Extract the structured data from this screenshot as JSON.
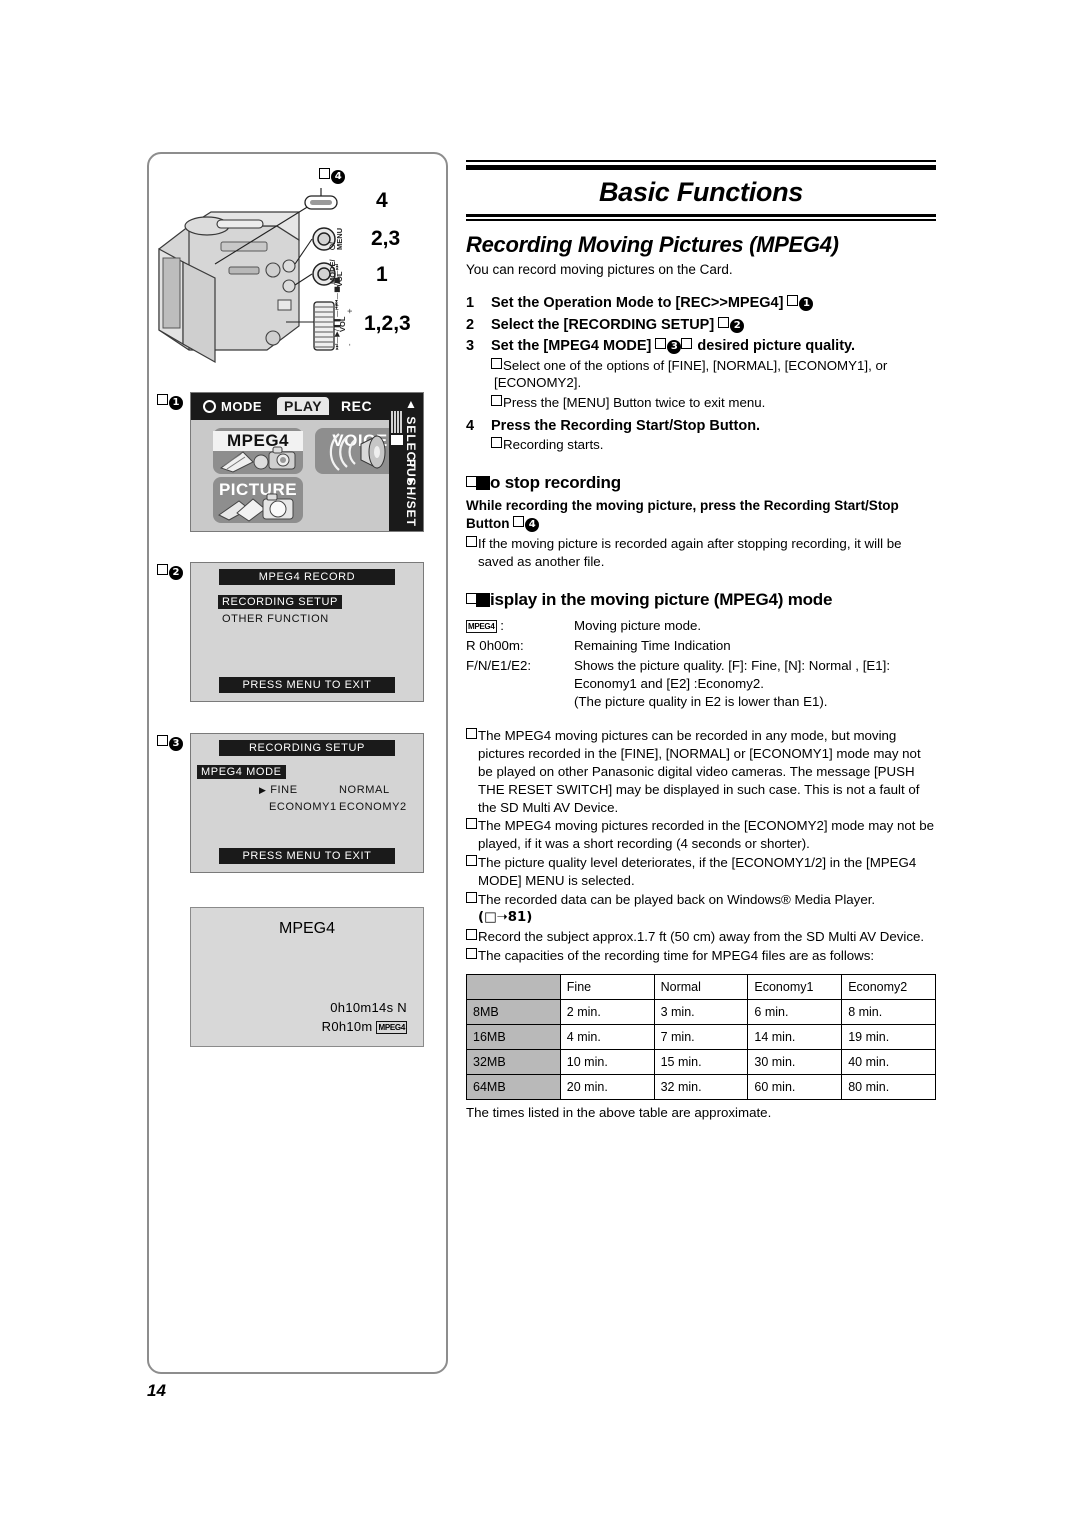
{
  "page_number": "14",
  "header": {
    "title": "Basic Functions"
  },
  "section": {
    "title": "Recording Moving Pictures (MPEG4)",
    "lede": "You can record moving pictures on the Card."
  },
  "steps": [
    {
      "num": "1",
      "text": "Set the Operation Mode to [REC>>MPEG4] ",
      "ref_box": "□",
      "ref_circle": "1",
      "notes": []
    },
    {
      "num": "2",
      "text": "Select the [RECORDING SETUP] ",
      "ref_box": "□",
      "ref_circle": "2",
      "notes": []
    },
    {
      "num": "3",
      "text": "Set the [MPEG4 MODE] ",
      "ref_box": "□",
      "ref_circle": "3",
      "text_after": " desired picture quality.",
      "notes": [
        "Select one of the options of [FINE], [NORMAL], [ECONOMY1], or [ECONOMY2].",
        "Press the [MENU] Button twice to exit menu."
      ]
    },
    {
      "num": "4",
      "text": "Press the Recording Start/Stop Button.",
      "notes": [
        "Recording starts."
      ]
    }
  ],
  "stop_recording": {
    "heading": "o stop recording",
    "bold_para": "While recording the moving picture, press the Recording Start/Stop Button ",
    "ref_box": "□",
    "ref_circle": "4",
    "note": "If the moving picture is recorded again after stopping recording, it will be saved as another file."
  },
  "display_mode": {
    "heading": "isplay in the moving picture (MPEG4) mode",
    "rows": [
      {
        "key_icon": "MPEG4",
        "key": " :",
        "value": "Moving picture mode."
      },
      {
        "key": "R 0h00m:",
        "value": "Remaining Time Indication"
      },
      {
        "key": "F/N/E1/E2:",
        "value": "Shows the picture quality. [F]: Fine, [N]: Normal , [E1]: Economy1 and [E2] :Economy2.",
        "value_line2": "(The picture quality in E2 is lower than E1)."
      }
    ]
  },
  "bullets": [
    "The MPEG4 moving pictures can be recorded in any mode, but moving pictures recorded in the [FINE], [NORMAL] or [ECONOMY1] mode may not be played on other Panasonic digital video cameras. The message [PUSH THE RESET SWITCH] may be displayed in such case. This is not a fault of the SD Multi AV Device.",
    "The MPEG4 moving pictures recorded in the [ECONOMY2] mode may not be played, if it was a short recording (4 seconds or shorter).",
    "The picture quality level deteriorates, if the [ECONOMY1/2] in the [MPEG4 MODE] MENU is selected.",
    "The recorded data can be played back on Windows® Media Player.",
    "Record the subject approx.1.7 ft (50 cm) away from the SD Multi AV Device.",
    "The capacities of the recording time for MPEG4 files are as follows:"
  ],
  "page_reference": "(□➝81)",
  "capacity_table": {
    "corner": "",
    "columns": [
      "Fine",
      "Normal",
      "Economy1",
      "Economy2"
    ],
    "rows": [
      {
        "label": "8MB",
        "cells": [
          "2 min.",
          "3 min.",
          "6 min.",
          "8 min."
        ]
      },
      {
        "label": "16MB",
        "cells": [
          "4 min.",
          "7 min.",
          "14 min.",
          "19 min."
        ]
      },
      {
        "label": "32MB",
        "cells": [
          "10 min.",
          "15 min.",
          "30 min.",
          "40 min."
        ]
      },
      {
        "label": "64MB",
        "cells": [
          "20 min.",
          "32 min.",
          "60 min.",
          "80 min."
        ]
      }
    ],
    "note": "The times listed in the above table are approximate."
  },
  "camera_diagram": {
    "callout_box": "□",
    "callout_circle": "4",
    "button_labels": [
      {
        "control": "⏻/MENU",
        "steps": "2,3"
      },
      {
        "control": "MODE/VOL",
        "steps": "1"
      },
      {
        "control": "VOL +/-",
        "steps": "1,2,3"
      }
    ],
    "step_markers": [
      "4",
      "2,3",
      "1",
      "1,2,3"
    ]
  },
  "screen_mode_select": {
    "ref_box": "□",
    "ref_circle": "1",
    "mode_label": "MODE",
    "tabs": [
      {
        "label": "PLAY",
        "selected": true
      },
      {
        "label": "REC",
        "selected": false
      }
    ],
    "tiles": [
      {
        "label": "MPEG4",
        "selected": true
      },
      {
        "label": "VOICE",
        "selected": false
      },
      {
        "label": "PICTURE",
        "selected": false
      }
    ],
    "side_push_set": "PUSH/SET",
    "side_select": "SELECT"
  },
  "screen_mpeg4_record": {
    "ref_box": "□",
    "ref_circle": "2",
    "title": "MPEG4 RECORD",
    "items": [
      {
        "label": "RECORDING  SETUP",
        "selected": true
      },
      {
        "label": "OTHER  FUNCTION",
        "selected": false
      }
    ],
    "footer": "PRESS MENU TO EXIT"
  },
  "screen_recording_setup": {
    "ref_box": "□",
    "ref_circle": "3",
    "title": "RECORDING  SETUP",
    "menu_label": "MPEG4  MODE",
    "options": [
      {
        "label": "FINE",
        "cursor": "▶"
      },
      {
        "label": "NORMAL",
        "cursor": ""
      },
      {
        "label": "ECONOMY1",
        "cursor": ""
      },
      {
        "label": "ECONOMY2",
        "cursor": ""
      }
    ],
    "footer": "PRESS MENU TO EXIT"
  },
  "screen_rec_display": {
    "title": "MPEG4",
    "elapsed": "0h10m14s  N",
    "remaining": "R0h10m",
    "badge": "MPEG4"
  }
}
